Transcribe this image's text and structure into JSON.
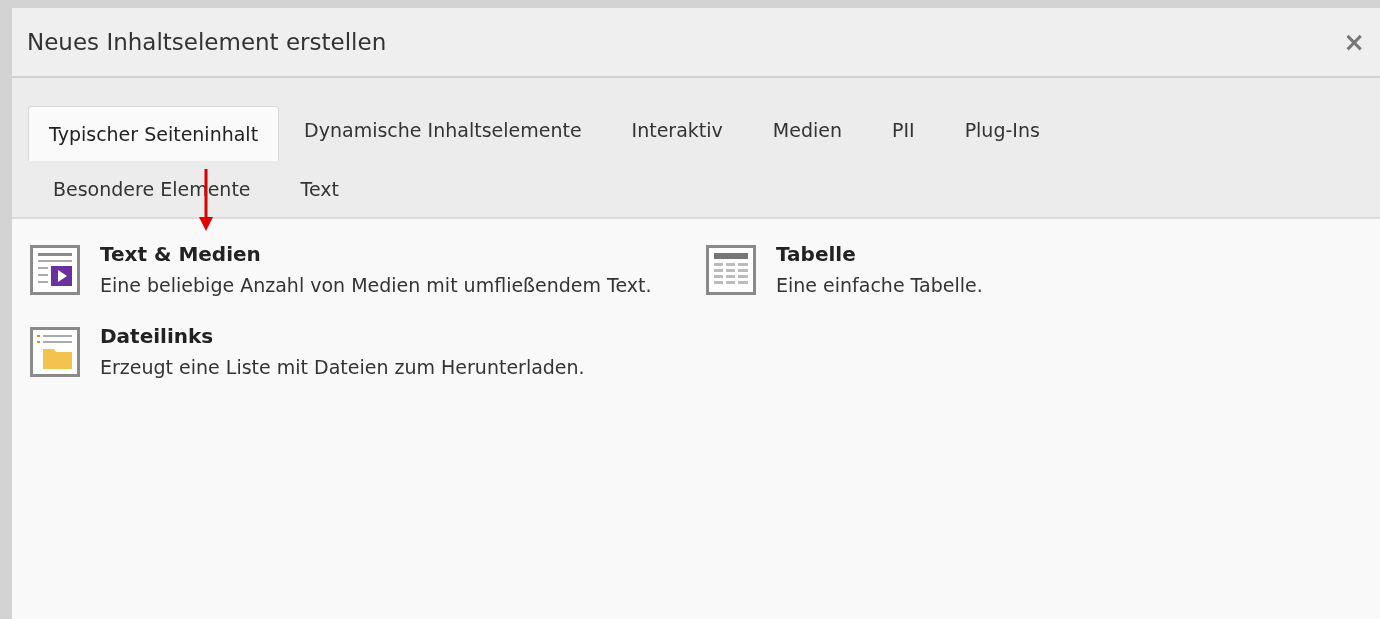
{
  "dialog": {
    "title": "Neues Inhaltselement erstellen",
    "close": "×"
  },
  "tabs": [
    {
      "label": "Typischer Seiteninhalt",
      "selected": true
    },
    {
      "label": "Dynamische Inhaltselemente",
      "selected": false
    },
    {
      "label": "Interaktiv",
      "selected": false
    },
    {
      "label": "Medien",
      "selected": false
    },
    {
      "label": "PII",
      "selected": false
    },
    {
      "label": "Plug-Ins",
      "selected": false
    },
    {
      "label": "Besondere Elemente",
      "selected": false
    },
    {
      "label": "Text",
      "selected": false
    }
  ],
  "elements": [
    {
      "kind": "media",
      "title": "Text & Medien",
      "description": "Eine beliebige Anzahl von Medien mit umfließendem Text."
    },
    {
      "kind": "table",
      "title": "Tabelle",
      "description": "Eine einfache Tabelle."
    },
    {
      "kind": "files",
      "title": "Dateilinks",
      "description": "Erzeugt eine Liste mit Dateien zum Herunterladen."
    }
  ]
}
